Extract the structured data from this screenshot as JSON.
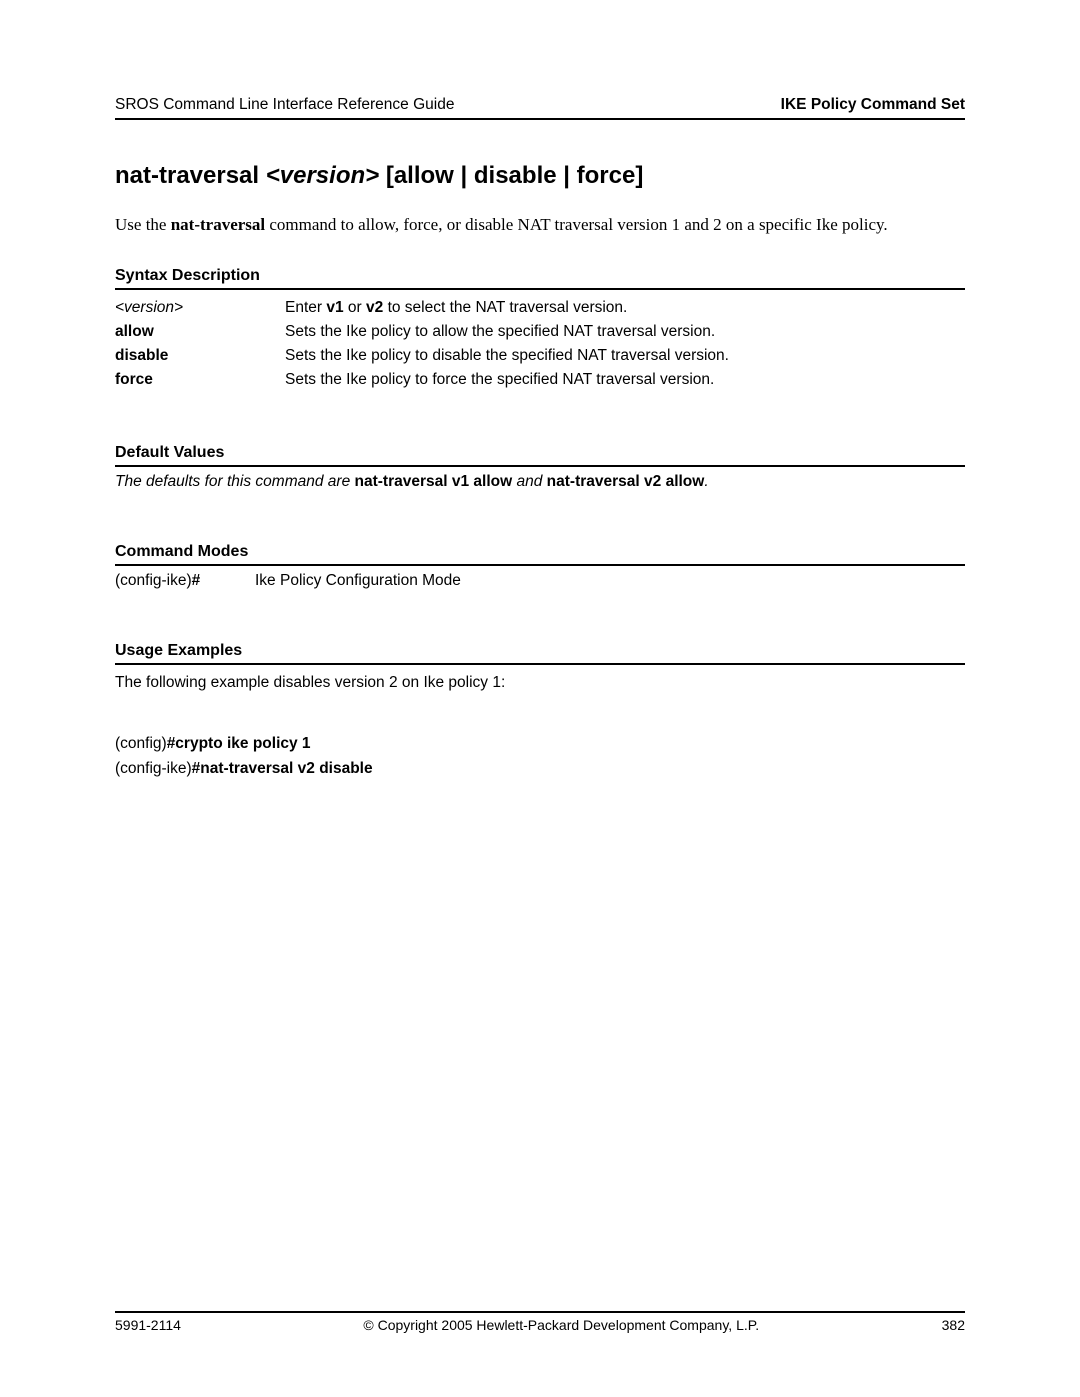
{
  "header": {
    "left": "SROS Command Line Interface Reference Guide",
    "right": "IKE Policy Command Set"
  },
  "title": {
    "cmd": "nat-traversal",
    "arg": "<version>",
    "options": "[allow | disable | force]"
  },
  "intro": {
    "pre": "Use the ",
    "bold": "nat-traversal",
    "post": " command to allow, force, or disable NAT traversal version 1 and 2 on a specific Ike policy."
  },
  "sections": {
    "syntax": "Syntax Description",
    "defaults": "Default Values",
    "modes": "Command Modes",
    "usage": "Usage Examples"
  },
  "syntax": [
    {
      "term": "<version>",
      "termStyle": "italic",
      "d1": "Enter ",
      "db1": "v1",
      "d2": " or ",
      "db2": "v2",
      "d3": " to select the NAT traversal version."
    },
    {
      "term": "allow",
      "termStyle": "bold",
      "desc": "Sets the Ike policy to allow the specified NAT traversal version."
    },
    {
      "term": "disable",
      "termStyle": "bold",
      "desc": "Sets the Ike policy to disable the specified NAT traversal version."
    },
    {
      "term": "force",
      "termStyle": "bold",
      "desc": "Sets the Ike policy to force the specified NAT traversal version."
    }
  ],
  "defaults": {
    "pre": "The defaults for this command are ",
    "b1": "nat-traversal v1 allow",
    "mid": " and ",
    "b2": "nat-traversal v2 allow",
    "post": "."
  },
  "modes": {
    "prompt_pre": "(config-ike)",
    "prompt_b": "#",
    "desc": "Ike Policy Configuration Mode"
  },
  "usage": {
    "intro": "The following example disables version 2 on Ike policy 1:",
    "l1_pre": "(config)",
    "l1_b": "#crypto ike policy 1",
    "l2_pre": "(config-ike)",
    "l2_b": "#nat-traversal v2 disable"
  },
  "footer": {
    "left": "5991-2114",
    "center": "© Copyright 2005 Hewlett-Packard Development Company, L.P.",
    "right": "382"
  }
}
